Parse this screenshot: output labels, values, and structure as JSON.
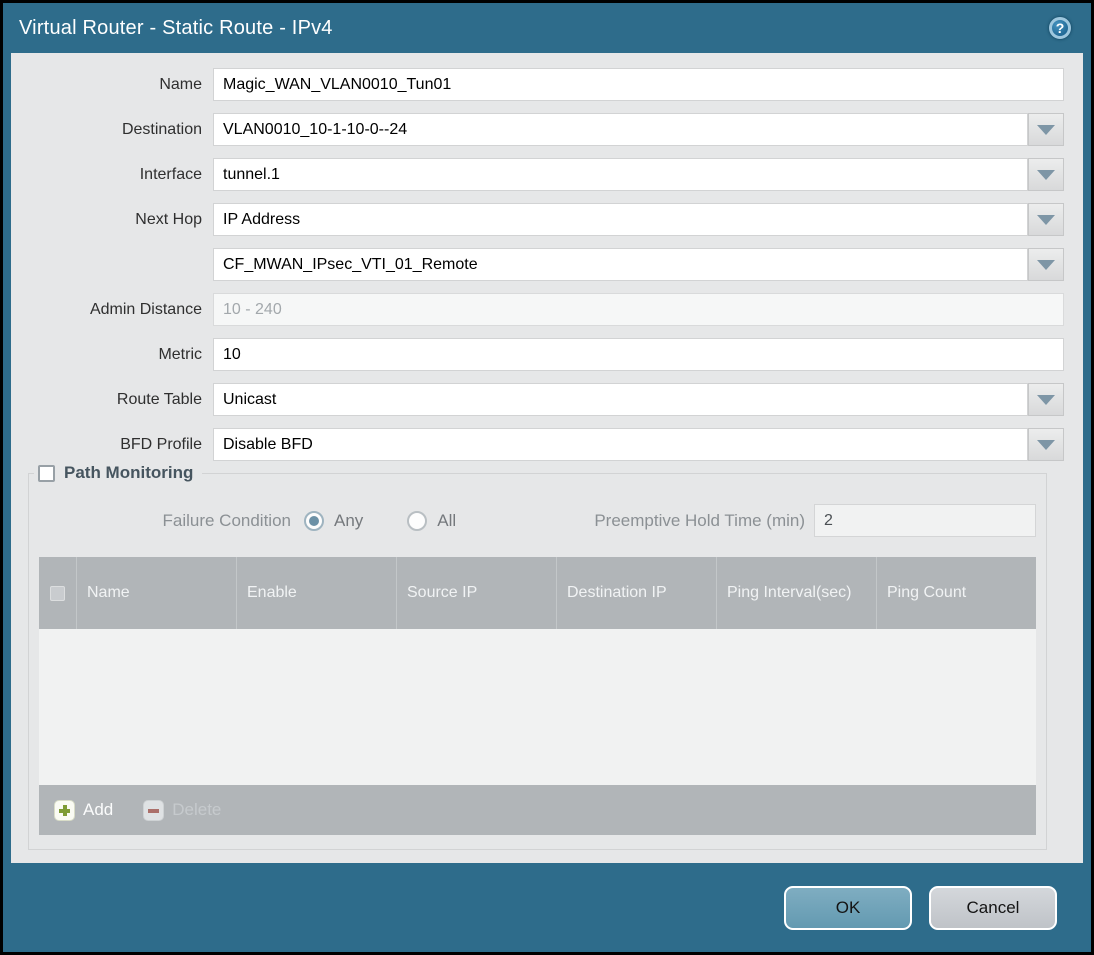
{
  "titlebar": {
    "title": "Virtual Router - Static Route - IPv4",
    "help_glyph": "?"
  },
  "form": {
    "name": {
      "label": "Name",
      "value": "Magic_WAN_VLAN0010_Tun01"
    },
    "destination": {
      "label": "Destination",
      "value": "VLAN0010_10-1-10-0--24"
    },
    "interface": {
      "label": "Interface",
      "value": "tunnel.1"
    },
    "next_hop": {
      "label": "Next Hop",
      "value": "IP Address"
    },
    "next_hop_address": {
      "value": "CF_MWAN_IPsec_VTI_01_Remote"
    },
    "admin_distance": {
      "label": "Admin Distance",
      "placeholder": "10 - 240"
    },
    "metric": {
      "label": "Metric",
      "value": "10"
    },
    "route_table": {
      "label": "Route Table",
      "value": "Unicast"
    },
    "bfd_profile": {
      "label": "BFD Profile",
      "value": "Disable BFD"
    }
  },
  "path_monitoring": {
    "title": "Path Monitoring",
    "checkbox_checked": false,
    "failure_condition": {
      "label": "Failure Condition",
      "options": [
        {
          "label": "Any",
          "selected": true
        },
        {
          "label": "All",
          "selected": false
        }
      ]
    },
    "preemptive_hold_time": {
      "label": "Preemptive Hold Time (min)",
      "value": "2"
    },
    "table": {
      "headers": [
        "Name",
        "Enable",
        "Source IP",
        "Destination IP",
        "Ping Interval(sec)",
        "Ping Count"
      ],
      "rows": [],
      "add_label": "Add",
      "delete_label": "Delete",
      "delete_enabled": false
    }
  },
  "footer": {
    "ok_label": "OK",
    "cancel_label": "Cancel"
  },
  "colors": {
    "titlebar_teal": "#2e6c8b",
    "content_gray": "#e6e7e8",
    "table_header_gray": "#b1b5b8",
    "ok_button_blue": "#6fa2b8",
    "add_plus_green": "#7f9c34",
    "delete_minus_red": "#ab6f6a",
    "radio_selected_fill": "#6c91a6"
  }
}
